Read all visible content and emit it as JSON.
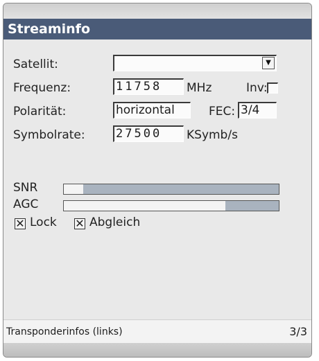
{
  "window": {
    "title": "Streaminfo"
  },
  "form": {
    "satellit": {
      "label": "Satellit:",
      "value": ""
    },
    "frequenz": {
      "label": "Frequenz:",
      "value": "11758",
      "unit": "MHz"
    },
    "inv": {
      "label": "Inv:",
      "checked": false
    },
    "polaritaet": {
      "label": "Polarität:",
      "value": "horizontal"
    },
    "fec": {
      "label": "FEC:",
      "value": "3/4"
    },
    "symbolrate": {
      "label": "Symbolrate:",
      "value": "27500",
      "unit": "KSymb/s"
    }
  },
  "signal": {
    "snr": {
      "label": "SNR",
      "level": 0.09
    },
    "agc": {
      "label": "AGC",
      "level": 0.75
    },
    "lock": {
      "label": "Lock",
      "checked": true
    },
    "abgleich": {
      "label": "Abgleich",
      "checked": true
    }
  },
  "status": {
    "text": "Transponderinfos (links)",
    "page": "3/3"
  },
  "icons": {
    "dropdown": "triangle-down-icon",
    "check": "x-mark-icon"
  },
  "colors": {
    "titlebar": "#4a5b78",
    "bar_fill": "#a9b3bf",
    "background": "#e9e9e9"
  }
}
